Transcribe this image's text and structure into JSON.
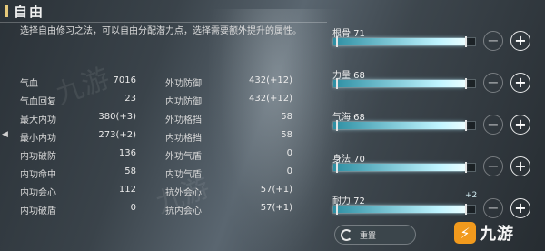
{
  "panel": {
    "title": "自由",
    "description": "选择自由修习之法，可以自由分配潜力点，选择需要额外提升的属性。"
  },
  "stats": [
    {
      "left_label": "气血",
      "left_value": "7016",
      "right_label": "外功防御",
      "right_value": "432(+12)"
    },
    {
      "left_label": "气血回复",
      "left_value": "23",
      "right_label": "内功防御",
      "right_value": "432(+12)"
    },
    {
      "left_label": "最大内功",
      "left_value": "380(+3)",
      "right_label": "外功格挡",
      "right_value": "58"
    },
    {
      "left_label": "最小内功",
      "left_value": "273(+2)",
      "right_label": "内功格挡",
      "right_value": "58"
    },
    {
      "left_label": "内功破防",
      "left_value": "136",
      "right_label": "外功气盾",
      "right_value": "0"
    },
    {
      "left_label": "内功命中",
      "left_value": "58",
      "right_label": "内功气盾",
      "right_value": "0"
    },
    {
      "left_label": "内功会心",
      "left_value": "112",
      "right_label": "抗外会心",
      "right_value": "57(+1)"
    },
    {
      "left_label": "内功破盾",
      "left_value": "0",
      "right_label": "抗内会心",
      "right_value": "57(+1)"
    }
  ],
  "attributes": [
    {
      "label": "根骨 71",
      "fill": 0.93,
      "extra": ""
    },
    {
      "label": "力量 68",
      "fill": 0.93,
      "extra": ""
    },
    {
      "label": "气海 68",
      "fill": 0.93,
      "extra": ""
    },
    {
      "label": "身法 70",
      "fill": 0.93,
      "extra": ""
    },
    {
      "label": "耐力 72",
      "fill": 0.93,
      "extra": "+2"
    }
  ],
  "buttons": {
    "minus_symbol": "−",
    "plus_symbol": "+",
    "reset_label": "重置"
  },
  "logo": {
    "mark": "⚡",
    "text": "九游"
  },
  "nav": {
    "left_arrow": "◀"
  }
}
